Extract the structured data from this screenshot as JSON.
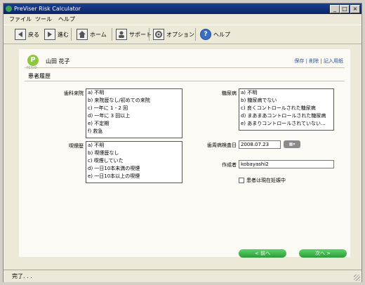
{
  "window": {
    "title": "PreViser Risk Calculator",
    "min_label": "_",
    "max_label": "□",
    "close_label": "×"
  },
  "menu": [
    "ファイル",
    "ツール",
    "ヘルプ"
  ],
  "toolbar": {
    "back": "戻る",
    "forward": "進む",
    "home": "ホーム",
    "support": "サポート",
    "options": "オプション",
    "help": "ヘルプ"
  },
  "header": {
    "logo_letter": "P",
    "logo_sub": "PERIO",
    "patient_name": "山田 花子",
    "link_save": "保存",
    "link_delete": "削除",
    "link_form": "記入用紙",
    "link_sep": "|"
  },
  "section_title": "患者履歴",
  "dental_visits": {
    "label": "歯科来院",
    "options": [
      "a) 不明",
      "b) 来院歴なし/初めての来院",
      "c) 一年に 1 - 2 回",
      "d) 一年に 3 回以上",
      "e) 不定期",
      "f) 救急"
    ]
  },
  "diabetes": {
    "label": "糖尿病",
    "options": [
      "a) 不明",
      "b) 糖尿病でない",
      "c) 良くコントロールされた糖尿病",
      "d) まあまあコントロールされた糖尿病",
      "e) あまりコントロールされていない..."
    ]
  },
  "smoking": {
    "label": "喫煙歴",
    "options": [
      "a) 不明",
      "b) 喫煙歴なし",
      "c) 喫煙していた",
      "d) 一日10本未満の喫煙",
      "e) 一日10本以上の喫煙"
    ]
  },
  "exam_date": {
    "label": "歯周病検査日",
    "value": "2008.07.23",
    "cal_label": "▦▾"
  },
  "author": {
    "label": "作成者",
    "value": "kobayashi2"
  },
  "pregnant": {
    "label": "患者は現在妊娠中",
    "checked": false
  },
  "nav": {
    "prev": "< 前へ",
    "next": "次へ >"
  },
  "status": "完了. . ."
}
